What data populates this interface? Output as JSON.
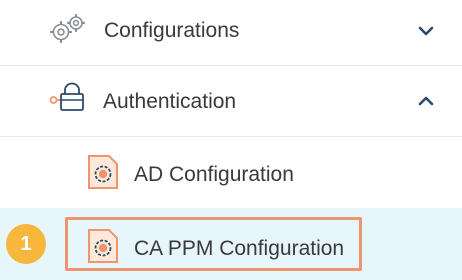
{
  "menu": {
    "configurations": {
      "label": "Configurations",
      "icon": "gears-icon",
      "chevron": "chevron-down-icon"
    },
    "authentication": {
      "label": "Authentication",
      "icon": "key-lock-icon",
      "chevron": "chevron-up-icon"
    },
    "ad_configuration": {
      "label": "AD Configuration",
      "icon": "config-gear-doc-icon"
    },
    "ca_ppm_configuration": {
      "label": "CA PPM Configuration",
      "icon": "config-gear-doc-icon",
      "selected": true
    }
  },
  "step_badge": "1",
  "colors": {
    "accent_orange": "#f0946e",
    "selected_background": "#e6f6fb",
    "badge": "#f6b73c",
    "icon_gray": "#8a8f96",
    "text": "#3a3a3a"
  }
}
